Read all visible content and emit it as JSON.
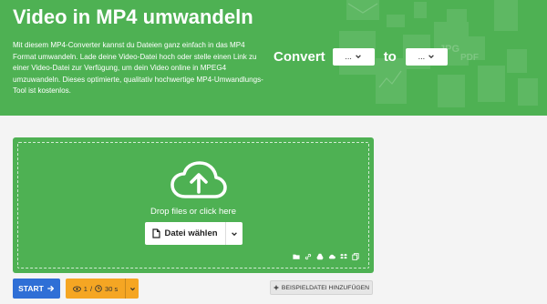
{
  "colors": {
    "brand_green": "#4eb153",
    "start_blue": "#2f6fd6",
    "options_orange": "#f5a623"
  },
  "hero": {
    "title": "Video in MP4 umwandeln",
    "description": "Mit diesem MP4-Converter kannst du Dateien ganz einfach in das MP4 Format umwandeln. Lade deine Video-Datei hoch oder stelle einen Link zu einer Video-Datei zur Verfügung, um dein Video online in MPEG4 umzuwandeln. Dieses optimierte, qualitativ hochwertige MP4-Umwandlungs-Tool ist kostenlos.",
    "decor_labels": [
      "JPG",
      "PDF"
    ]
  },
  "converter": {
    "convert_label": "Convert",
    "to_label": "to",
    "from_value": "...",
    "to_value": "..."
  },
  "upload": {
    "drop_text": "Drop files or click here",
    "choose_label": "Datei wählen",
    "icons": [
      "folder-icon",
      "link-icon",
      "google-drive-icon",
      "cloud-icon",
      "dropbox-icon",
      "clipboard-icon"
    ]
  },
  "actions": {
    "start_label": "START",
    "options_count": "1",
    "options_separator": "/",
    "options_seconds": "30 s",
    "sample_label": "BEISPIELDATEI HINZUFÜGEN"
  }
}
